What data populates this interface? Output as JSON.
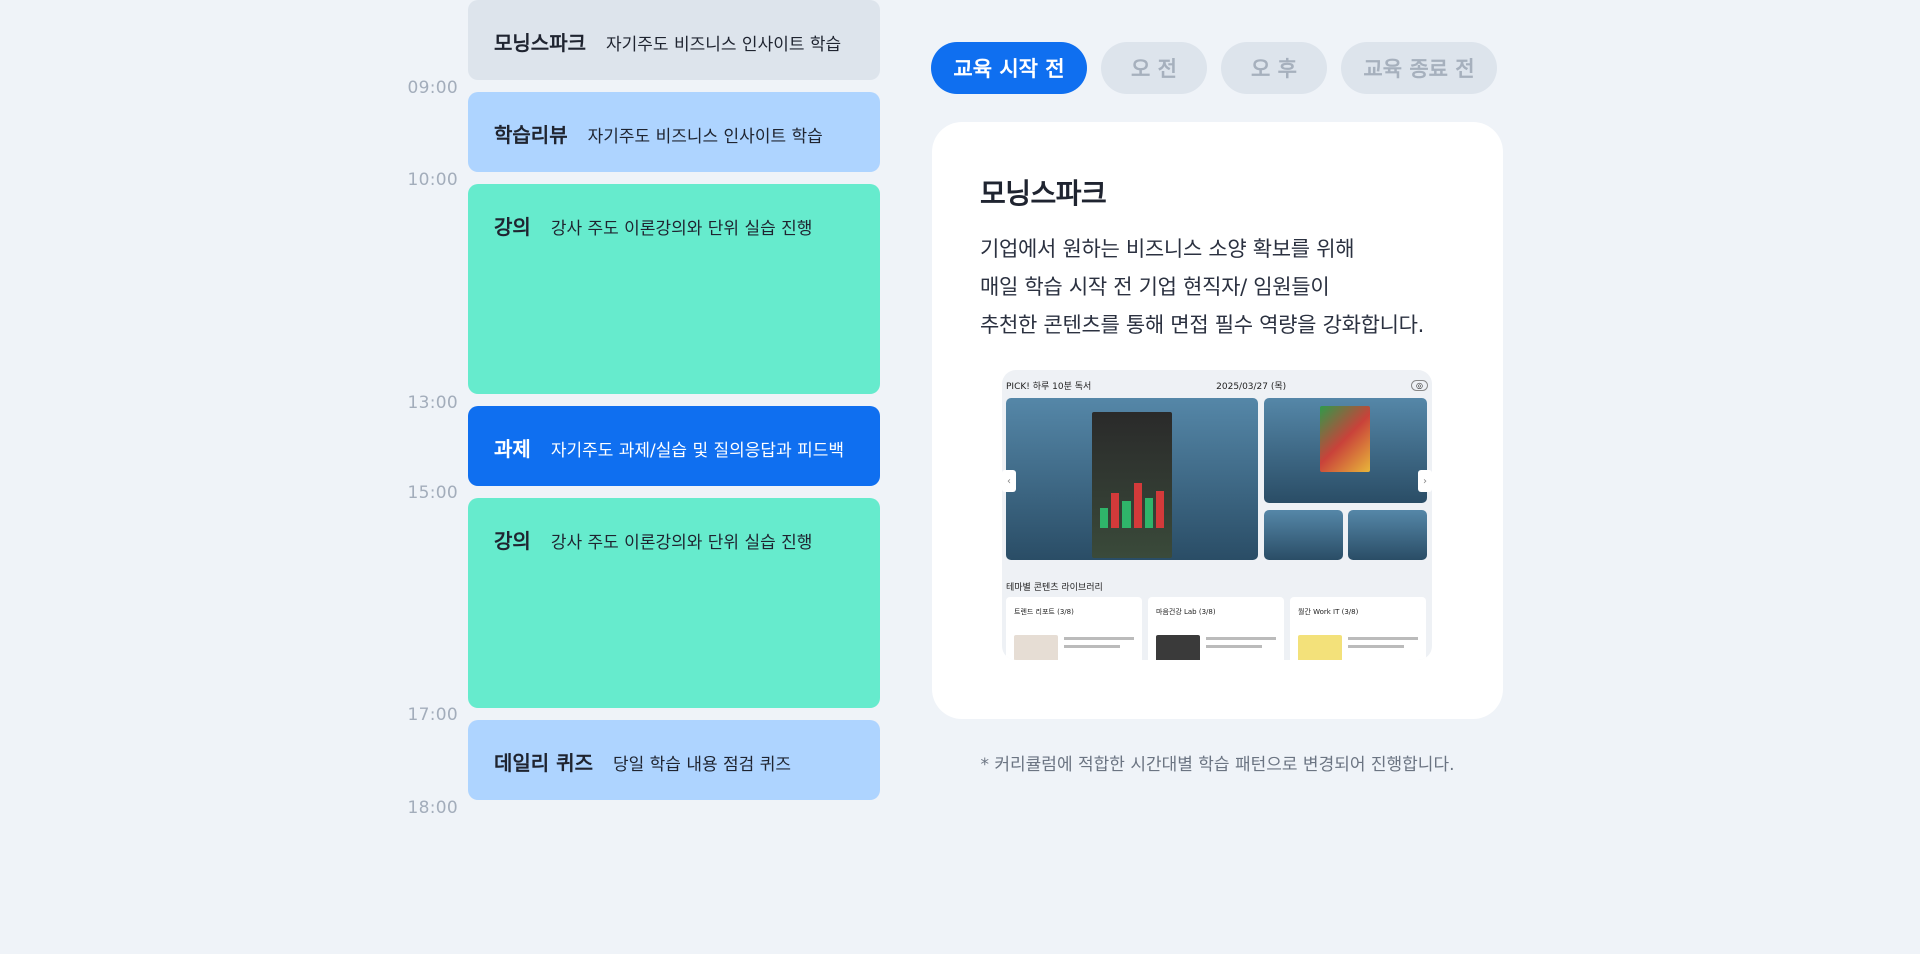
{
  "timeline": {
    "times": [
      "09:00",
      "10:00",
      "13:00",
      "15:00",
      "17:00",
      "18:00"
    ],
    "blocks": [
      {
        "title": "모닝스파크",
        "desc": "자기주도 비즈니스 인사이트 학습"
      },
      {
        "title": "학습리뷰",
        "desc": "자기주도 비즈니스 인사이트 학습"
      },
      {
        "title": "강의",
        "desc": "강사 주도 이론강의와 단위 실습 진행"
      },
      {
        "title": "과제",
        "desc": "자기주도 과제/실습 및 질의응답과 피드백"
      },
      {
        "title": "강의",
        "desc": "강사 주도 이론강의와 단위 실습 진행"
      },
      {
        "title": "데일리 퀴즈",
        "desc": "당일 학습 내용 점검 퀴즈"
      }
    ]
  },
  "tabs": [
    "교육 시작 전",
    "오 전",
    "오 후",
    "교육 종료 전"
  ],
  "card": {
    "title": "모닝스파크",
    "lines": [
      "기업에서 원하는 비즈니스 소양 확보를 위해",
      "매일 학습 시작 전 기업 현직자/ 임원들이",
      "추천한 콘텐츠를 통해 면접 필수 역량을 강화합니다."
    ],
    "screenshot": {
      "header": "PICK! 하루 10분 독서",
      "date": "2025/03/27 (목)",
      "library": "테마별 콘텐츠 라이브러리",
      "library_cards": [
        "트렌드 리포트 (3/8)",
        "마음건강 Lab (3/8)",
        "월간 Work IT (3/8)"
      ]
    }
  },
  "note": "* 커리큘럼에 적합한 시간대별 학습 패턴으로 변경되어 진행합니다."
}
